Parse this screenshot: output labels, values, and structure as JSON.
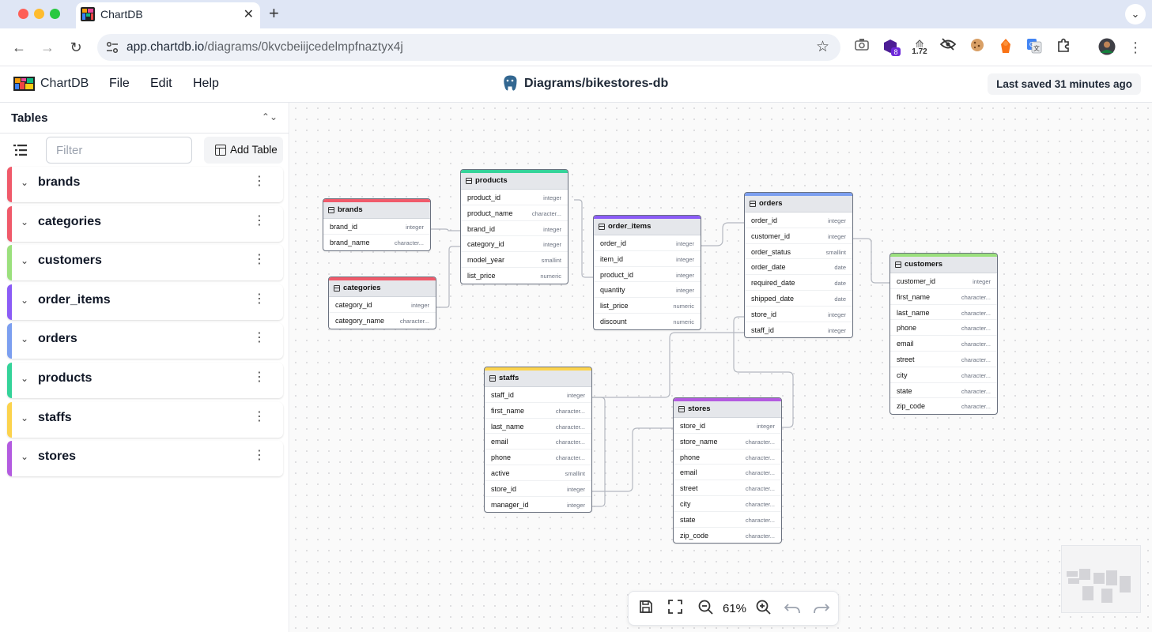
{
  "browser": {
    "tab_title": "ChartDB",
    "tab_close": "✕",
    "new_tab": "+",
    "tab_menu": "⌄",
    "url_host": "app.chartdb.io",
    "url_path": "/diagrams/0kvcbeiijcedelmpfnaztyx4j",
    "ext_badge": "8",
    "ext_counter": "1.72",
    "nav_back": "←",
    "nav_forward": "→",
    "nav_reload": "↻",
    "star": "☆",
    "menu": "⋮"
  },
  "app": {
    "name": "ChartDB",
    "menus": [
      "File",
      "Edit",
      "Help"
    ],
    "diagram_title": "Diagrams/bikestores-db",
    "last_saved": "Last saved 31 minutes ago"
  },
  "sidebar": {
    "title": "Tables",
    "sort_icon": "⌃⌄",
    "filter_placeholder": "Filter",
    "add_table_label": "Add Table",
    "chevron": "⌄",
    "dots": "⋮",
    "items": [
      {
        "label": "brands",
        "color": "#f05a6a"
      },
      {
        "label": "categories",
        "color": "#f05a6a"
      },
      {
        "label": "customers",
        "color": "#9be07d"
      },
      {
        "label": "order_items",
        "color": "#8b5cf6"
      },
      {
        "label": "orders",
        "color": "#7c9ff0"
      },
      {
        "label": "products",
        "color": "#34d399"
      },
      {
        "label": "staffs",
        "color": "#fcd34d"
      },
      {
        "label": "stores",
        "color": "#b35be0"
      }
    ]
  },
  "tables": {
    "brands": {
      "name": "brands",
      "color": "#f05a6a",
      "columns": [
        {
          "name": "brand_id",
          "type": "integer"
        },
        {
          "name": "brand_name",
          "type": "character..."
        }
      ]
    },
    "categories": {
      "name": "categories",
      "color": "#f05a6a",
      "columns": [
        {
          "name": "category_id",
          "type": "integer"
        },
        {
          "name": "category_name",
          "type": "character..."
        }
      ]
    },
    "products": {
      "name": "products",
      "color": "#34d399",
      "columns": [
        {
          "name": "product_id",
          "type": "integer"
        },
        {
          "name": "product_name",
          "type": "character..."
        },
        {
          "name": "brand_id",
          "type": "integer"
        },
        {
          "name": "category_id",
          "type": "integer"
        },
        {
          "name": "model_year",
          "type": "smallint"
        },
        {
          "name": "list_price",
          "type": "numeric"
        }
      ]
    },
    "order_items": {
      "name": "order_items",
      "color": "#8b5cf6",
      "columns": [
        {
          "name": "order_id",
          "type": "integer"
        },
        {
          "name": "item_id",
          "type": "integer"
        },
        {
          "name": "product_id",
          "type": "integer"
        },
        {
          "name": "quantity",
          "type": "integer"
        },
        {
          "name": "list_price",
          "type": "numeric"
        },
        {
          "name": "discount",
          "type": "numeric"
        }
      ]
    },
    "orders": {
      "name": "orders",
      "color": "#7c9ff0",
      "columns": [
        {
          "name": "order_id",
          "type": "integer"
        },
        {
          "name": "customer_id",
          "type": "integer"
        },
        {
          "name": "order_status",
          "type": "smallint"
        },
        {
          "name": "order_date",
          "type": "date"
        },
        {
          "name": "required_date",
          "type": "date"
        },
        {
          "name": "shipped_date",
          "type": "date"
        },
        {
          "name": "store_id",
          "type": "integer"
        },
        {
          "name": "staff_id",
          "type": "integer"
        }
      ]
    },
    "customers": {
      "name": "customers",
      "color": "#9be07d",
      "columns": [
        {
          "name": "customer_id",
          "type": "integer"
        },
        {
          "name": "first_name",
          "type": "character..."
        },
        {
          "name": "last_name",
          "type": "character..."
        },
        {
          "name": "phone",
          "type": "character..."
        },
        {
          "name": "email",
          "type": "character..."
        },
        {
          "name": "street",
          "type": "character..."
        },
        {
          "name": "city",
          "type": "character..."
        },
        {
          "name": "state",
          "type": "character..."
        },
        {
          "name": "zip_code",
          "type": "character..."
        }
      ]
    },
    "staffs": {
      "name": "staffs",
      "color": "#fcd34d",
      "columns": [
        {
          "name": "staff_id",
          "type": "integer"
        },
        {
          "name": "first_name",
          "type": "character..."
        },
        {
          "name": "last_name",
          "type": "character..."
        },
        {
          "name": "email",
          "type": "character..."
        },
        {
          "name": "phone",
          "type": "character..."
        },
        {
          "name": "active",
          "type": "smallint"
        },
        {
          "name": "store_id",
          "type": "integer"
        },
        {
          "name": "manager_id",
          "type": "integer"
        }
      ]
    },
    "stores": {
      "name": "stores",
      "color": "#b35be0",
      "columns": [
        {
          "name": "store_id",
          "type": "integer"
        },
        {
          "name": "store_name",
          "type": "character..."
        },
        {
          "name": "phone",
          "type": "character..."
        },
        {
          "name": "email",
          "type": "character..."
        },
        {
          "name": "street",
          "type": "character..."
        },
        {
          "name": "city",
          "type": "character..."
        },
        {
          "name": "state",
          "type": "character..."
        },
        {
          "name": "zip_code",
          "type": "character..."
        }
      ]
    }
  },
  "controls": {
    "zoom": "61%"
  }
}
